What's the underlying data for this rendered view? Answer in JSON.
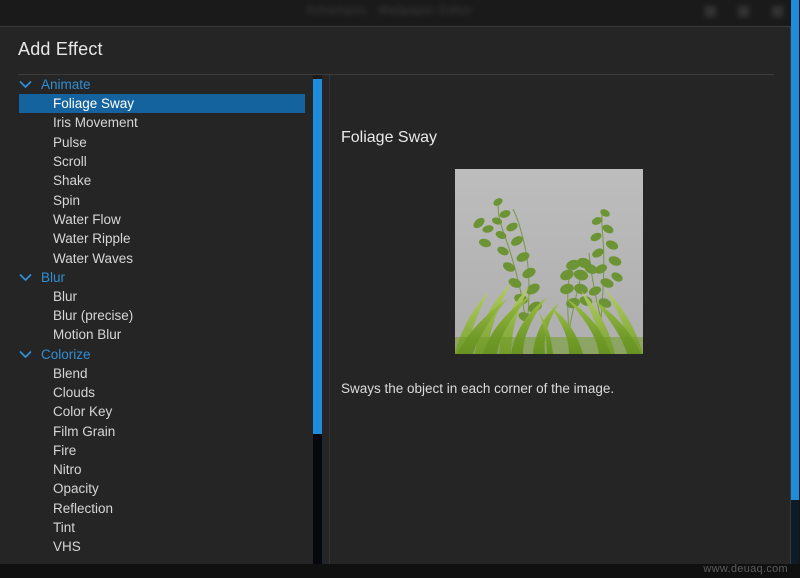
{
  "background_window": {
    "titlebar_text_1": "Ashampoo",
    "titlebar_text_2": "Wallpaper Editor",
    "accent_color": "#1e8bdb"
  },
  "dialog": {
    "title": "Add Effect",
    "accent_color": "#1e8bdb",
    "selection_color": "#15639e",
    "group_label_color": "#2f8fd4"
  },
  "tree": {
    "chevron_icon": "chevron-down-icon",
    "groups": [
      {
        "label": "Animate",
        "expanded": true,
        "items": [
          {
            "label": "Foliage Sway",
            "selected": true
          },
          {
            "label": "Iris Movement",
            "selected": false
          },
          {
            "label": "Pulse",
            "selected": false
          },
          {
            "label": "Scroll",
            "selected": false
          },
          {
            "label": "Shake",
            "selected": false
          },
          {
            "label": "Spin",
            "selected": false
          },
          {
            "label": "Water Flow",
            "selected": false
          },
          {
            "label": "Water Ripple",
            "selected": false
          },
          {
            "label": "Water Waves",
            "selected": false
          }
        ]
      },
      {
        "label": "Blur",
        "expanded": true,
        "items": [
          {
            "label": "Blur",
            "selected": false
          },
          {
            "label": "Blur (precise)",
            "selected": false
          },
          {
            "label": "Motion Blur",
            "selected": false
          }
        ]
      },
      {
        "label": "Colorize",
        "expanded": true,
        "items": [
          {
            "label": "Blend",
            "selected": false
          },
          {
            "label": "Clouds",
            "selected": false
          },
          {
            "label": "Color Key",
            "selected": false
          },
          {
            "label": "Film Grain",
            "selected": false
          },
          {
            "label": "Fire",
            "selected": false
          },
          {
            "label": "Nitro",
            "selected": false
          },
          {
            "label": "Opacity",
            "selected": false
          },
          {
            "label": "Reflection",
            "selected": false
          },
          {
            "label": "Tint",
            "selected": false
          },
          {
            "label": "VHS",
            "selected": false
          }
        ]
      }
    ]
  },
  "detail": {
    "title": "Foliage Sway",
    "description": "Sways the object in each corner of the image.",
    "preview_alt": "foliage-preview-image"
  },
  "watermark": {
    "text": "www.deuaq.com"
  }
}
